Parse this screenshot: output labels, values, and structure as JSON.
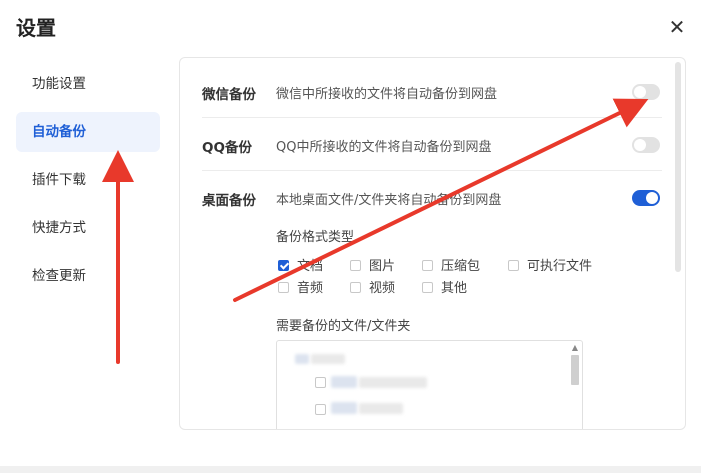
{
  "dialog": {
    "title": "设置",
    "close_icon": "close-icon"
  },
  "sidebar": {
    "items": [
      {
        "label": "功能设置",
        "active": false
      },
      {
        "label": "自动备份",
        "active": true
      },
      {
        "label": "插件下载",
        "active": false
      },
      {
        "label": "快捷方式",
        "active": false
      },
      {
        "label": "检查更新",
        "active": false
      }
    ]
  },
  "backup": {
    "wechat": {
      "label": "微信备份",
      "desc": "微信中所接收的文件将自动备份到网盘",
      "enabled": false
    },
    "qq": {
      "label": "QQ备份",
      "desc": "QQ中所接收的文件将自动备份到网盘",
      "enabled": false
    },
    "desktop": {
      "label": "桌面备份",
      "desc": "本地桌面文件/文件夹将自动备份到网盘",
      "enabled": true
    },
    "format_title": "备份格式类型",
    "formats": [
      {
        "label": "文档",
        "checked": true
      },
      {
        "label": "图片",
        "checked": false
      },
      {
        "label": "压缩包",
        "checked": false
      },
      {
        "label": "可执行文件",
        "checked": false
      },
      {
        "label": "音频",
        "checked": false
      },
      {
        "label": "视频",
        "checked": false
      },
      {
        "label": "其他",
        "checked": false
      }
    ],
    "folder_title": "需要备份的文件/文件夹"
  },
  "colors": {
    "accent": "#1f5fd6",
    "annotation_arrow": "#e8392b"
  }
}
